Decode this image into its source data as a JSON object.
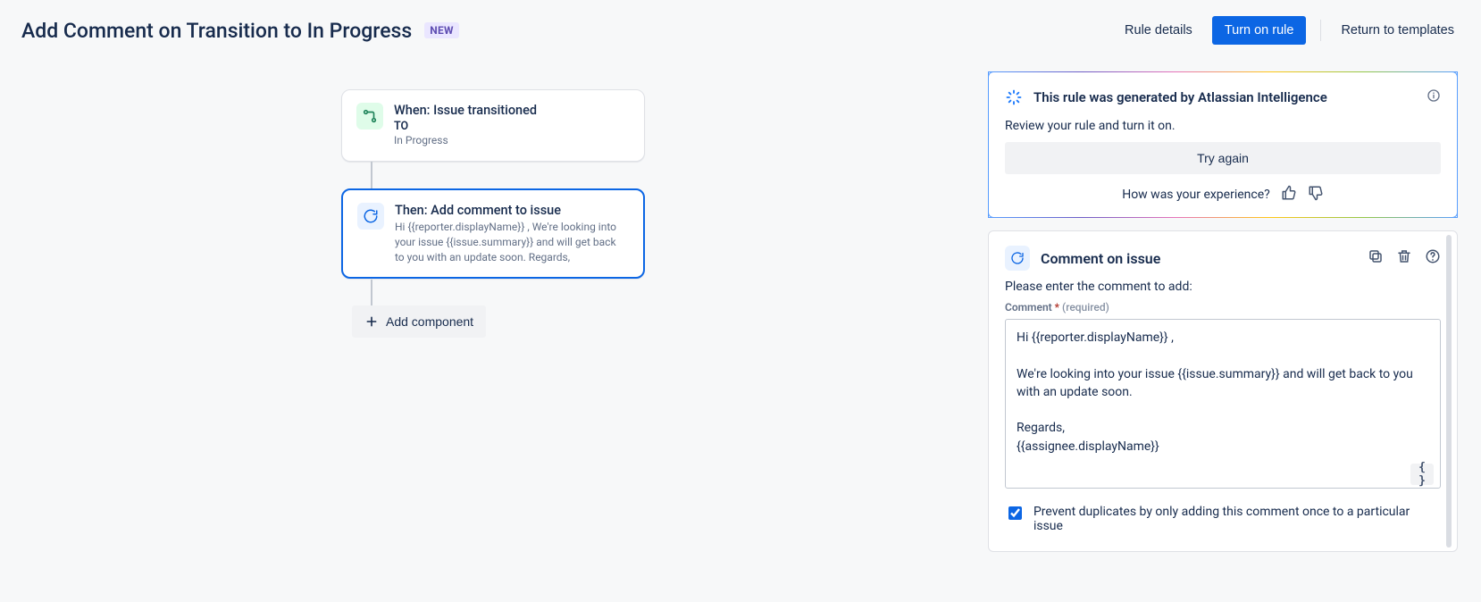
{
  "header": {
    "title": "Add Comment on Transition to In Progress",
    "badge": "NEW",
    "rule_details": "Rule details",
    "turn_on": "Turn on rule",
    "return": "Return to templates"
  },
  "trigger": {
    "title": "When: Issue transitioned",
    "to_label": "TO",
    "to_value": "In Progress"
  },
  "action": {
    "title": "Then: Add comment to issue",
    "desc": "Hi {{reporter.displayName}} , We're looking into your issue {{issue.summary}} and will get back to you with an update soon. Regards,"
  },
  "add_component": "Add component",
  "ai": {
    "title": "This rule was generated by Atlassian Intelligence",
    "review": "Review your rule and turn it on.",
    "try_again": "Try again",
    "feedback": "How was your experience?"
  },
  "comment_panel": {
    "title": "Comment on issue",
    "prompt": "Please enter the comment to add:",
    "label": "Comment",
    "required_hint": "(required)",
    "text": "Hi {{reporter.displayName}} ,\n\nWe're looking into your issue {{issue.summary}} and will get back to you with an update soon.\n\nRegards,\n{{assignee.displayName}}",
    "checkbox": "Prevent duplicates by only adding this comment once to a particular issue"
  },
  "icons": {
    "trigger": "transition-icon",
    "action": "refresh-icon",
    "plus": "plus-icon",
    "ai": "ai-sparkle-icon",
    "info": "info-icon",
    "thumb_up": "thumb-up-icon",
    "thumb_down": "thumb-down-icon",
    "copy": "copy-icon",
    "trash": "trash-icon",
    "help": "help-icon",
    "smart": "smart-values-icon"
  }
}
